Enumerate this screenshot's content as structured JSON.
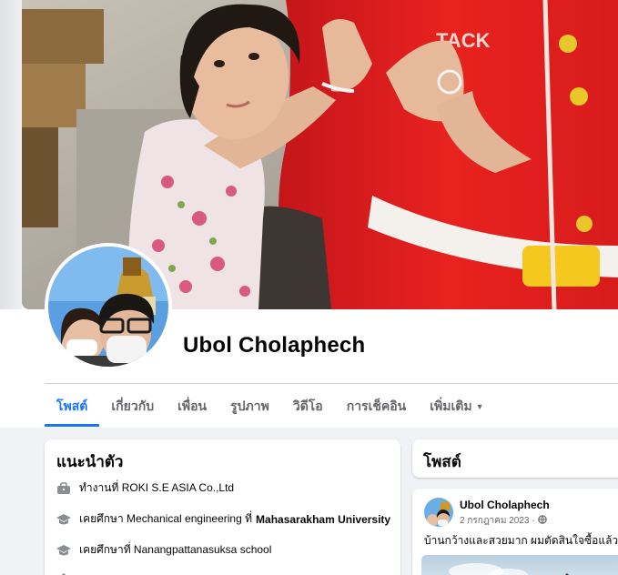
{
  "profile": {
    "name": "Ubol Cholaphech"
  },
  "cover": {
    "sign_text": "TACK"
  },
  "tabs": [
    {
      "label": "โพสต์",
      "active": true
    },
    {
      "label": "เกี่ยวกับ",
      "active": false
    },
    {
      "label": "เพื่อน",
      "active": false
    },
    {
      "label": "รูปภาพ",
      "active": false
    },
    {
      "label": "วิดีโอ",
      "active": false
    },
    {
      "label": "การเช็คอิน",
      "active": false
    },
    {
      "label": "เพิ่มเติม",
      "active": false,
      "icon": "caret-down-icon"
    }
  ],
  "intro": {
    "title": "แนะนำตัว",
    "items": [
      {
        "icon": "briefcase-icon",
        "text": "ทำงานที่ ROKI S.E ASIA Co.,Ltd",
        "bold": ""
      },
      {
        "icon": "graduation-cap-icon",
        "text": "เคยศึกษา Mechanical engineering ที่",
        "bold": "Mahasarakham University"
      },
      {
        "icon": "graduation-cap-icon",
        "text": "เคยศึกษาที่ Nanangpattanasuksa school",
        "bold": ""
      }
    ]
  },
  "posts": {
    "title": "โพสต์",
    "items": [
      {
        "author": "Ubol Cholaphech",
        "date": "2 กรกฎาคม 2023 ·",
        "privacy_icon": "globe-icon",
        "text": "บ้านกว้างและสวยมาก ผมตัดสินใจซื้อแล้วครับ"
      }
    ]
  },
  "colors": {
    "accent": "#1877f2",
    "background": "#f0f2f5",
    "secondary_text": "#65676b"
  }
}
